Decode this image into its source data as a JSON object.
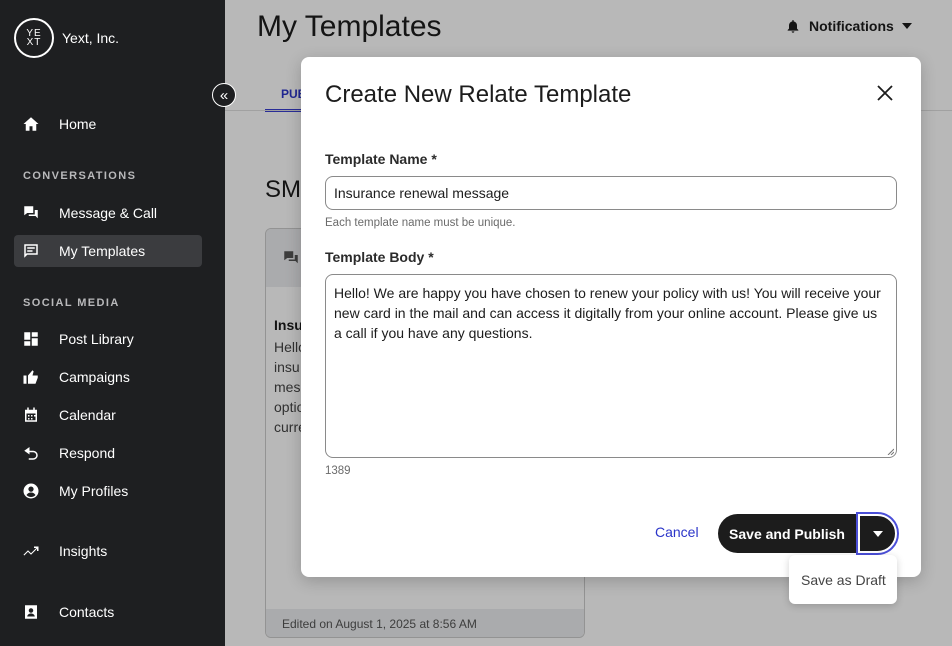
{
  "brand": {
    "name": "Yext, Inc.",
    "logo_text": "YE XT"
  },
  "sidebar": {
    "home": "Home",
    "sections": {
      "conversations": "CONVERSATIONS",
      "social_media": "SOCIAL MEDIA"
    },
    "items": [
      {
        "label": "Message & Call",
        "icon": "chat-icon"
      },
      {
        "label": "My Templates",
        "icon": "template-icon",
        "active": true
      },
      {
        "label": "Post Library",
        "icon": "grid-icon"
      },
      {
        "label": "Campaigns",
        "icon": "thumbs-up-icon"
      },
      {
        "label": "Calendar",
        "icon": "calendar-icon"
      },
      {
        "label": "Respond",
        "icon": "reply-icon"
      },
      {
        "label": "My Profiles",
        "icon": "profile-icon"
      },
      {
        "label": "Insights",
        "icon": "trend-icon"
      },
      {
        "label": "Contacts",
        "icon": "contacts-icon"
      }
    ]
  },
  "header": {
    "title": "My Templates",
    "notifications": "Notifications"
  },
  "background": {
    "tab": "PUB",
    "heading": "SM",
    "card_title": "Insu",
    "card_text": "Hello\ninsu\nmes\noptio\ncurre",
    "card_footer": "Edited on August 1, 2025 at 8:56 AM"
  },
  "modal": {
    "title": "Create New Relate Template",
    "name_label": "Template Name *",
    "name_value": "Insurance renewal message",
    "name_hint": "Each template name must be unique.",
    "body_label": "Template Body *",
    "body_value": "Hello! We are happy you have chosen to renew your policy with us! You will receive your new card in the mail and can access it digitally from your online account. Please give us a call if you have any questions.",
    "char_count": "1389",
    "cancel": "Cancel",
    "primary": "Save and Publish",
    "dropdown_option": "Save as Draft"
  }
}
